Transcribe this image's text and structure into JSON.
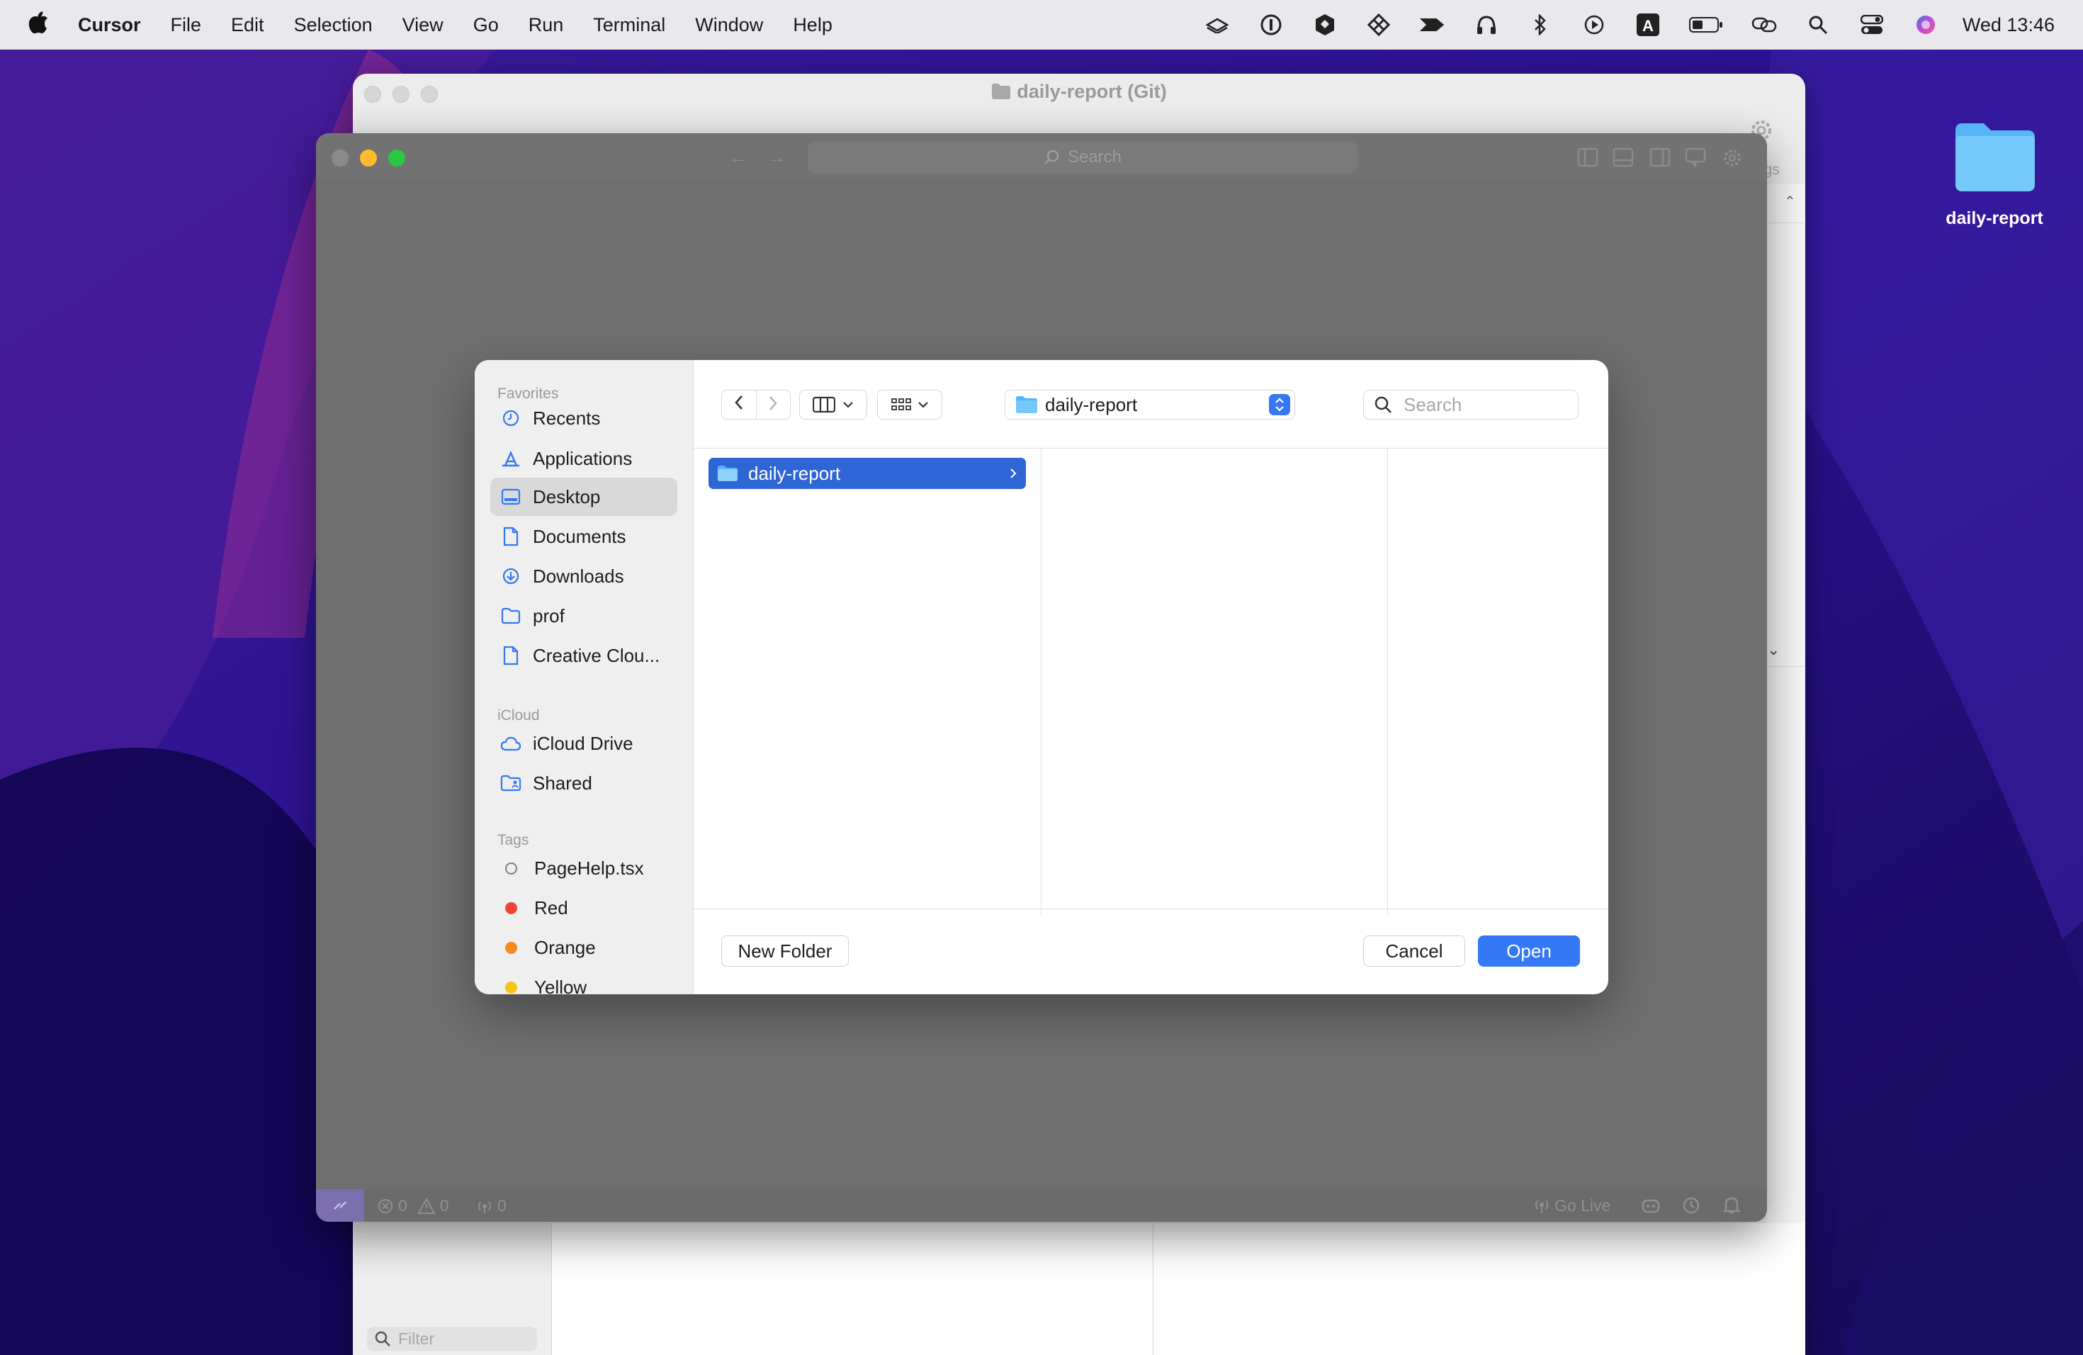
{
  "menubar": {
    "app_name": "Cursor",
    "menus": [
      "File",
      "Edit",
      "Selection",
      "View",
      "Go",
      "Run",
      "Terminal",
      "Window",
      "Help"
    ],
    "clock": "Wed 13:46",
    "status_icons": [
      "cloud-stack-icon",
      "one-password-icon",
      "shield-icon",
      "tailscale-icon",
      "airplane-icon",
      "headphones-icon",
      "bluetooth-icon",
      "play-icon",
      "keyboard-input-icon",
      "battery-icon",
      "link-icon",
      "spotlight-icon",
      "control-center-icon",
      "siri-icon"
    ]
  },
  "git_window": {
    "title": "daily-report (Git)",
    "filter_placeholder": "Filter",
    "partial_label": "ngs"
  },
  "ide_window": {
    "search_placeholder": "Search",
    "status": {
      "errors": "0",
      "warnings": "0",
      "ports": "0",
      "go_live": "Go Live"
    }
  },
  "dialog": {
    "sidebar": {
      "favorites_header": "Favorites",
      "favorites": [
        {
          "label": "Recents",
          "icon": "clock-icon"
        },
        {
          "label": "Applications",
          "icon": "applications-icon"
        },
        {
          "label": "Desktop",
          "icon": "desktop-icon",
          "selected": true
        },
        {
          "label": "Documents",
          "icon": "document-icon"
        },
        {
          "label": "Downloads",
          "icon": "download-icon"
        },
        {
          "label": "prof",
          "icon": "folder-icon"
        },
        {
          "label": "Creative Clou...",
          "icon": "file-icon"
        }
      ],
      "icloud_header": "iCloud",
      "icloud": [
        {
          "label": "iCloud Drive",
          "icon": "cloud-icon"
        },
        {
          "label": "Shared",
          "icon": "shared-folder-icon"
        }
      ],
      "tags_header": "Tags",
      "tags": [
        {
          "label": "PageHelp.tsx",
          "color": "none"
        },
        {
          "label": "Red",
          "color": "#f0443a"
        },
        {
          "label": "Orange",
          "color": "#f58a1f"
        },
        {
          "label": "Yellow",
          "color": "#f5c518"
        }
      ]
    },
    "location": "daily-report",
    "search_placeholder": "Search",
    "selected_item": "daily-report",
    "new_folder_label": "New Folder",
    "cancel_label": "Cancel",
    "open_label": "Open"
  },
  "desktop": {
    "folder_label": "daily-report"
  },
  "colors": {
    "accent": "#3478f6",
    "selection": "#2f66d5",
    "traffic_red": "#fe5f57",
    "traffic_yellow": "#febc2e",
    "traffic_green": "#28c840"
  }
}
